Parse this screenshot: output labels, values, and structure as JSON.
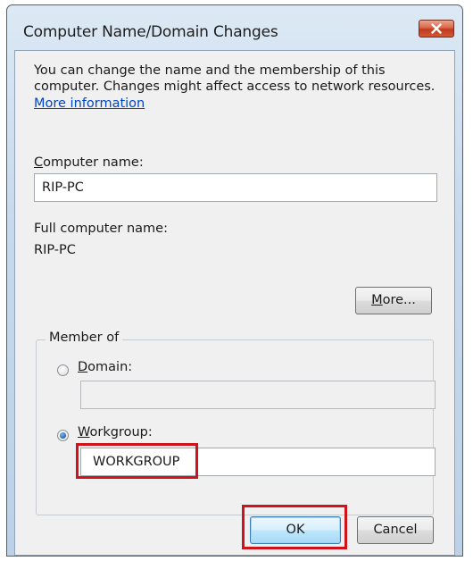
{
  "window": {
    "title": "Computer Name/Domain Changes"
  },
  "description": {
    "line1": "You can change the name and the membership of this",
    "line2": "computer. Changes might affect access to network resources.",
    "link": "More information"
  },
  "computer_name": {
    "label_accel": "C",
    "label_rest": "omputer name:",
    "value": "RIP-PC"
  },
  "full_name": {
    "label": "Full computer name:",
    "value": "RIP-PC"
  },
  "more_button": {
    "label_accel": "M",
    "label_rest": "ore..."
  },
  "member_of": {
    "legend": "Member of",
    "domain": {
      "label_accel": "D",
      "label_rest": "omain:",
      "value": "",
      "selected": false
    },
    "workgroup": {
      "label_accel": "W",
      "label_rest": "orkgroup:",
      "value": "WORKGROUP",
      "selected": true
    }
  },
  "buttons": {
    "ok": "OK",
    "cancel": "Cancel"
  },
  "icons": {
    "close": "close-icon"
  },
  "colors": {
    "highlight": "#d0121c",
    "link": "#0046c8",
    "close_button": "#c2391b"
  }
}
